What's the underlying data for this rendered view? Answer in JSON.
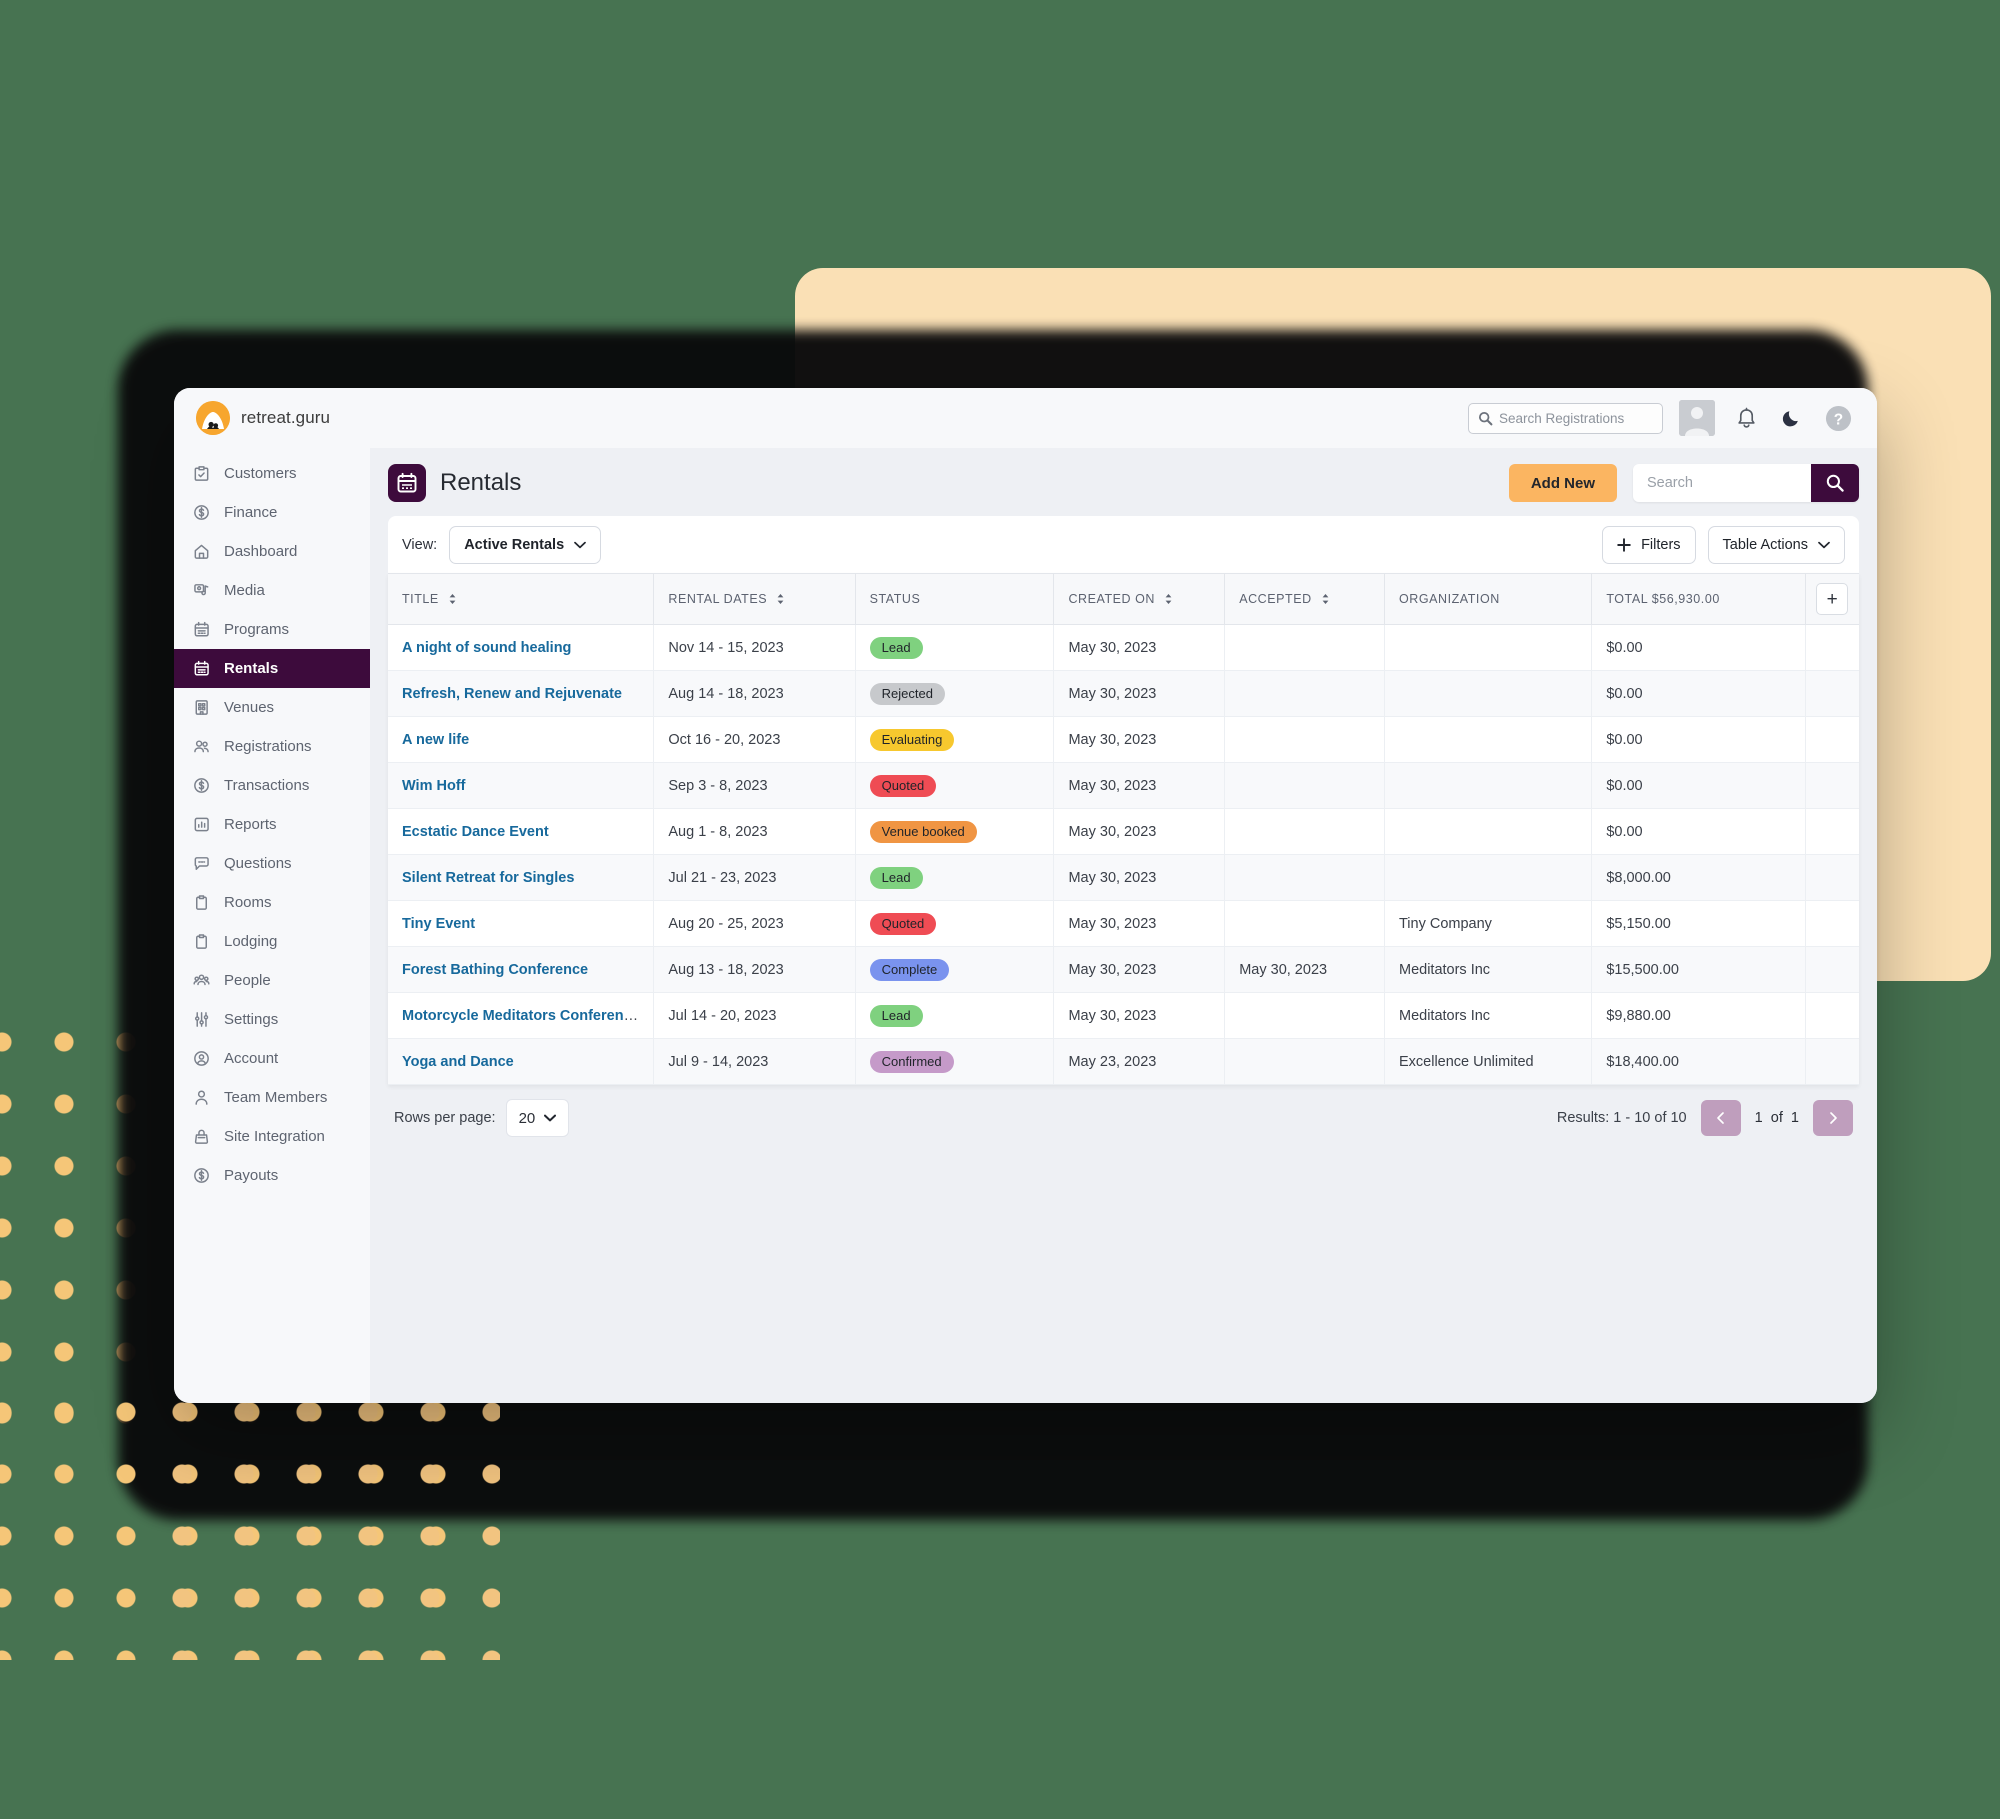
{
  "brand": {
    "name": "retreat.guru",
    "logo_icon": "retreat-guru-logo"
  },
  "topbar": {
    "global_search_placeholder": "Search Registrations",
    "icons": [
      "avatar",
      "bell-icon",
      "moon-icon",
      "help-icon"
    ]
  },
  "sidebar": {
    "items": [
      {
        "label": "Customers",
        "icon": "clipboard-check-icon",
        "active": false
      },
      {
        "label": "Finance",
        "icon": "dollar-circle-icon",
        "active": false
      },
      {
        "label": "Dashboard",
        "icon": "home-icon",
        "active": false
      },
      {
        "label": "Media",
        "icon": "media-icon",
        "active": false
      },
      {
        "label": "Programs",
        "icon": "calendar-icon",
        "active": false
      },
      {
        "label": "Rentals",
        "icon": "calendar-icon",
        "active": true
      },
      {
        "label": "Venues",
        "icon": "building-icon",
        "active": false
      },
      {
        "label": "Registrations",
        "icon": "users-icon",
        "active": false
      },
      {
        "label": "Transactions",
        "icon": "dollar-circle-icon",
        "active": false
      },
      {
        "label": "Reports",
        "icon": "bar-chart-icon",
        "active": false
      },
      {
        "label": "Questions",
        "icon": "chat-icon",
        "active": false
      },
      {
        "label": "Rooms",
        "icon": "clipboard-icon",
        "active": false
      },
      {
        "label": "Lodging",
        "icon": "clipboard-icon",
        "active": false
      },
      {
        "label": "People",
        "icon": "people-group-icon",
        "active": false
      },
      {
        "label": "Settings",
        "icon": "sliders-icon",
        "active": false
      },
      {
        "label": "Account",
        "icon": "user-circle-icon",
        "active": false
      },
      {
        "label": "Team Members",
        "icon": "user-icon",
        "active": false
      },
      {
        "label": "Site Integration",
        "icon": "bag-icon",
        "active": false
      },
      {
        "label": "Payouts",
        "icon": "dollar-circle-icon",
        "active": false
      }
    ]
  },
  "page": {
    "title": "Rentals",
    "icon": "calendar-icon",
    "add_new_label": "Add New",
    "search_placeholder": "Search",
    "search_value": "",
    "search_icon": "search-icon"
  },
  "toolbar": {
    "view_label": "View:",
    "view_value": "Active Rentals",
    "filters_label": "Filters",
    "filters_icon": "plus-icon",
    "table_actions_label": "Table Actions",
    "chevron_icon": "chevron-down-icon"
  },
  "table": {
    "columns": [
      {
        "label": "TITLE",
        "sortable": true
      },
      {
        "label": "RENTAL DATES",
        "sortable": true
      },
      {
        "label": "STATUS",
        "sortable": false
      },
      {
        "label": "CREATED ON",
        "sortable": true
      },
      {
        "label": "ACCEPTED",
        "sortable": true
      },
      {
        "label": "ORGANIZATION",
        "sortable": false
      },
      {
        "label": "TOTAL $56,930.00",
        "sortable": false
      }
    ],
    "add_column_icon": "plus-icon",
    "rows": [
      {
        "title": "A night of sound healing",
        "dates": "Nov 14 - 15, 2023",
        "status": "Lead",
        "status_color": "#7fd17f",
        "created": "May 30, 2023",
        "accepted": "",
        "organization": "",
        "total": "$0.00"
      },
      {
        "title": "Refresh, Renew and Rejuvenate",
        "dates": "Aug 14 - 18, 2023",
        "status": "Rejected",
        "status_color": "#c7c9cc",
        "created": "May 30, 2023",
        "accepted": "",
        "organization": "",
        "total": "$0.00"
      },
      {
        "title": "A new life",
        "dates": "Oct 16 - 20, 2023",
        "status": "Evaluating",
        "status_color": "#f7c82e",
        "created": "May 30, 2023",
        "accepted": "",
        "organization": "",
        "total": "$0.00"
      },
      {
        "title": "Wim Hoff",
        "dates": "Sep 3 - 8, 2023",
        "status": "Quoted",
        "status_color": "#ef4c54",
        "created": "May 30, 2023",
        "accepted": "",
        "organization": "",
        "total": "$0.00"
      },
      {
        "title": "Ecstatic Dance Event",
        "dates": "Aug 1 - 8, 2023",
        "status": "Venue booked",
        "status_color": "#f09543",
        "created": "May 30, 2023",
        "accepted": "",
        "organization": "",
        "total": "$0.00"
      },
      {
        "title": "Silent Retreat for Singles",
        "dates": "Jul 21 - 23, 2023",
        "status": "Lead",
        "status_color": "#7fd17f",
        "created": "May 30, 2023",
        "accepted": "",
        "organization": "",
        "total": "$8,000.00"
      },
      {
        "title": "Tiny Event",
        "dates": "Aug 20 - 25, 2023",
        "status": "Quoted",
        "status_color": "#ef4c54",
        "created": "May 30, 2023",
        "accepted": "",
        "organization": "Tiny Company",
        "total": "$5,150.00"
      },
      {
        "title": "Forest Bathing Conference",
        "dates": "Aug 13 - 18, 2023",
        "status": "Complete",
        "status_color": "#7a93ee",
        "created": "May 30, 2023",
        "accepted": "May 30, 2023",
        "organization": "Meditators Inc",
        "total": "$15,500.00"
      },
      {
        "title": "Motorcycle Meditators Conference",
        "dates": "Jul 14 - 20, 2023",
        "status": "Lead",
        "status_color": "#7fd17f",
        "created": "May 30, 2023",
        "accepted": "",
        "organization": "Meditators Inc",
        "total": "$9,880.00"
      },
      {
        "title": "Yoga and Dance",
        "dates": "Jul 9 - 14, 2023",
        "status": "Confirmed",
        "status_color": "#c59ac9",
        "created": "May 23, 2023",
        "accepted": "",
        "organization": "Excellence Unlimited",
        "total": "$18,400.00"
      }
    ]
  },
  "footer": {
    "rows_label": "Rows per page:",
    "rows_value": "20",
    "results": "Results: 1 - 10 of 10",
    "page_current": "1",
    "page_of": "of",
    "page_total": "1",
    "prev_icon": "chevron-left-icon",
    "next_icon": "chevron-right-icon"
  },
  "colors": {
    "background": "#477351",
    "brand_purple": "#3d0b3c",
    "accent_orange": "#fbb561",
    "peach_panel": "#fae0b5",
    "dot_pattern": "#f5c678",
    "link_blue": "#17699c",
    "pager_mauve": "#bf9ebd"
  }
}
